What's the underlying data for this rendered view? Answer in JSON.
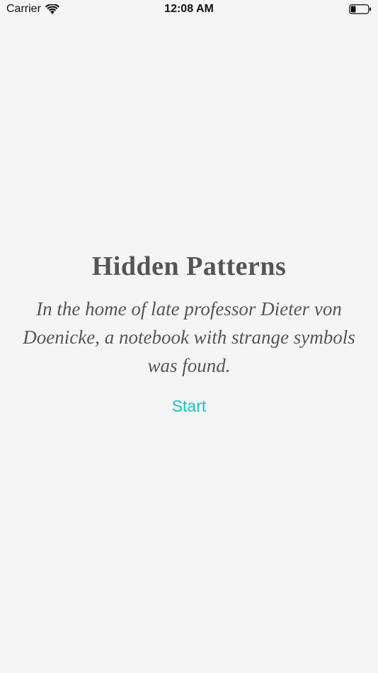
{
  "status_bar": {
    "carrier": "Carrier",
    "time": "12:08 AM",
    "wifi_icon": "wifi-icon",
    "battery_icon": "battery-icon",
    "battery_level": 0.3
  },
  "main": {
    "title": "Hidden Patterns",
    "subtitle": "In the home of late professor Dieter von Doenicke, a notebook with strange symbols was found.",
    "start_label": "Start"
  },
  "colors": {
    "background": "#f5f5f5",
    "text": "#555555",
    "accent": "#17c5c8"
  }
}
